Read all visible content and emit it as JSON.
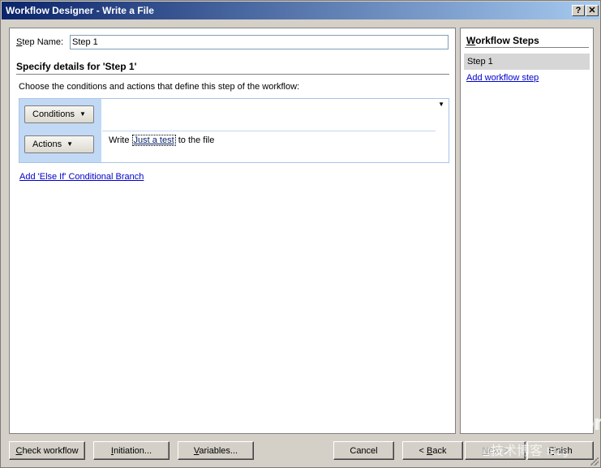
{
  "window": {
    "title": "Workflow Designer - Write a File",
    "help_glyph": "?",
    "close_glyph": "✕"
  },
  "step": {
    "label_underlined": "S",
    "label_rest": "tep Name:",
    "value": "Step 1",
    "section_title": "Specify details for 'Step 1'",
    "instruction": "Choose the conditions and actions that define this step of the workflow:"
  },
  "rule": {
    "conditions_label": "Conditions",
    "actions_label": "Actions",
    "action_prefix": "Write",
    "action_param": "Just a test",
    "action_suffix": "to the file",
    "else_if_link": "Add 'Else If' Conditional Branch"
  },
  "workflow_steps": {
    "title_underlined": "W",
    "title_rest": "orkflow Steps",
    "steps": [
      "Step 1"
    ],
    "add_link": "Add workflow step"
  },
  "buttons": {
    "check_workflow": {
      "u": "C",
      "rest": "heck workflow"
    },
    "initiation": {
      "u": "I",
      "rest": "nitiation..."
    },
    "variables": {
      "u": "V",
      "rest": "ariables..."
    },
    "cancel": "Cancel",
    "back": {
      "pre": "< ",
      "u": "B",
      "rest": "ack"
    },
    "next": {
      "u": "N",
      "rest": "ext >"
    },
    "finish": {
      "u": "F",
      "rest": "inish"
    }
  },
  "watermark": {
    "main": "51CTO.com",
    "sub": "技术博客",
    "tag": "Blog"
  }
}
